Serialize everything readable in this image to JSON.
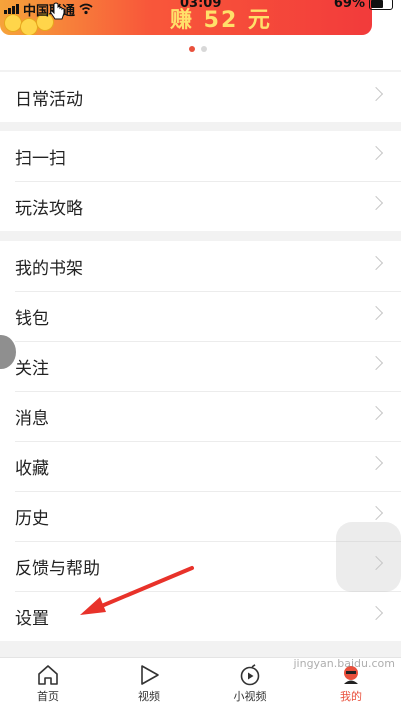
{
  "status_bar": {
    "carrier": "中国联通",
    "time": "03:09",
    "battery": "69%"
  },
  "banner": {
    "text": "赚 52 元",
    "dots": [
      true,
      false
    ]
  },
  "groups": [
    {
      "items": [
        {
          "label": "日常活动"
        }
      ]
    },
    {
      "items": [
        {
          "label": "扫一扫"
        },
        {
          "label": "玩法攻略"
        }
      ]
    },
    {
      "items": [
        {
          "label": "我的书架"
        },
        {
          "label": "钱包"
        },
        {
          "label": "关注"
        },
        {
          "label": "消息"
        },
        {
          "label": "收藏"
        },
        {
          "label": "历史"
        },
        {
          "label": "反馈与帮助"
        },
        {
          "label": "设置"
        }
      ]
    }
  ],
  "tabbar": {
    "tabs": [
      {
        "label": "首页",
        "icon": "home-icon",
        "active": false
      },
      {
        "label": "视频",
        "icon": "play-icon",
        "active": false
      },
      {
        "label": "小视频",
        "icon": "short-video-icon",
        "active": false
      },
      {
        "label": "我的",
        "icon": "profile-icon",
        "active": true
      }
    ]
  },
  "watermark": "jingyan.baidu.com",
  "colors": {
    "accent": "#e9503c",
    "annotation_arrow": "#e8322a"
  }
}
